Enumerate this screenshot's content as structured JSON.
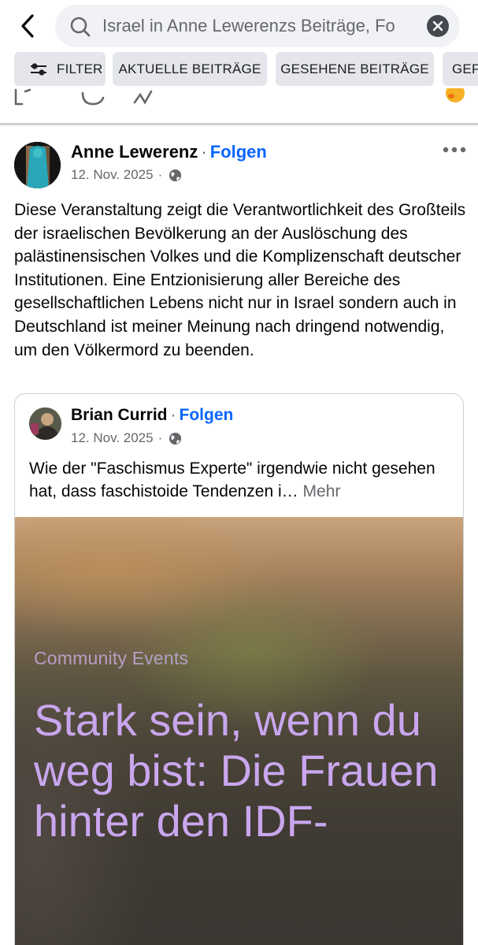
{
  "search": {
    "query": "Israel in Anne Lewerenzs Beiträge, Fo"
  },
  "chips": {
    "filter": "FILTER",
    "aktuell": "AKTUELLE BEITRÄGE",
    "gesehen": "GESEHENE BEITRÄGE",
    "gep": "GEP"
  },
  "post": {
    "author": "Anne Lewerenz",
    "separator": "·",
    "follow": "Folgen",
    "date": "12. Nov. 2025",
    "meta_sep": "·",
    "text": "Diese Veranstaltung zeigt die Verantwortlichkeit des Großteils der israelischen Bevölkerung an der Auslöschung des palästinensischen Volkes und die Komplizenschaft deutscher Institutionen. Eine Entzionisierung aller Bereiche des gesellschaftlichen Lebens nicht nur in Israel sondern auch in Deutschland ist meiner Meinung nach dringend notwendig, um den Völkermord zu beenden."
  },
  "shared": {
    "author": "Brian Currid",
    "separator": "·",
    "follow": "Folgen",
    "date": "12. Nov. 2025",
    "meta_sep": "·",
    "text": "Wie der \"Faschismus Experte\" irgendwie nicht gesehen hat, dass faschistoide Tendenzen i…",
    "more": "Mehr",
    "image_caption": "Community Events",
    "image_title": "Stark sein, wenn du weg bist: Die Frauen hinter den IDF-"
  },
  "colors": {
    "accent": "#0866ff",
    "secondary_text": "#65676b",
    "chip_bg": "#e4e6eb",
    "image_title": "#c9a6ee"
  },
  "icons": [
    "back-arrow-icon",
    "search-icon",
    "clear-icon",
    "filter-sliders-icon",
    "globe-icon",
    "more-dots-icon"
  ]
}
